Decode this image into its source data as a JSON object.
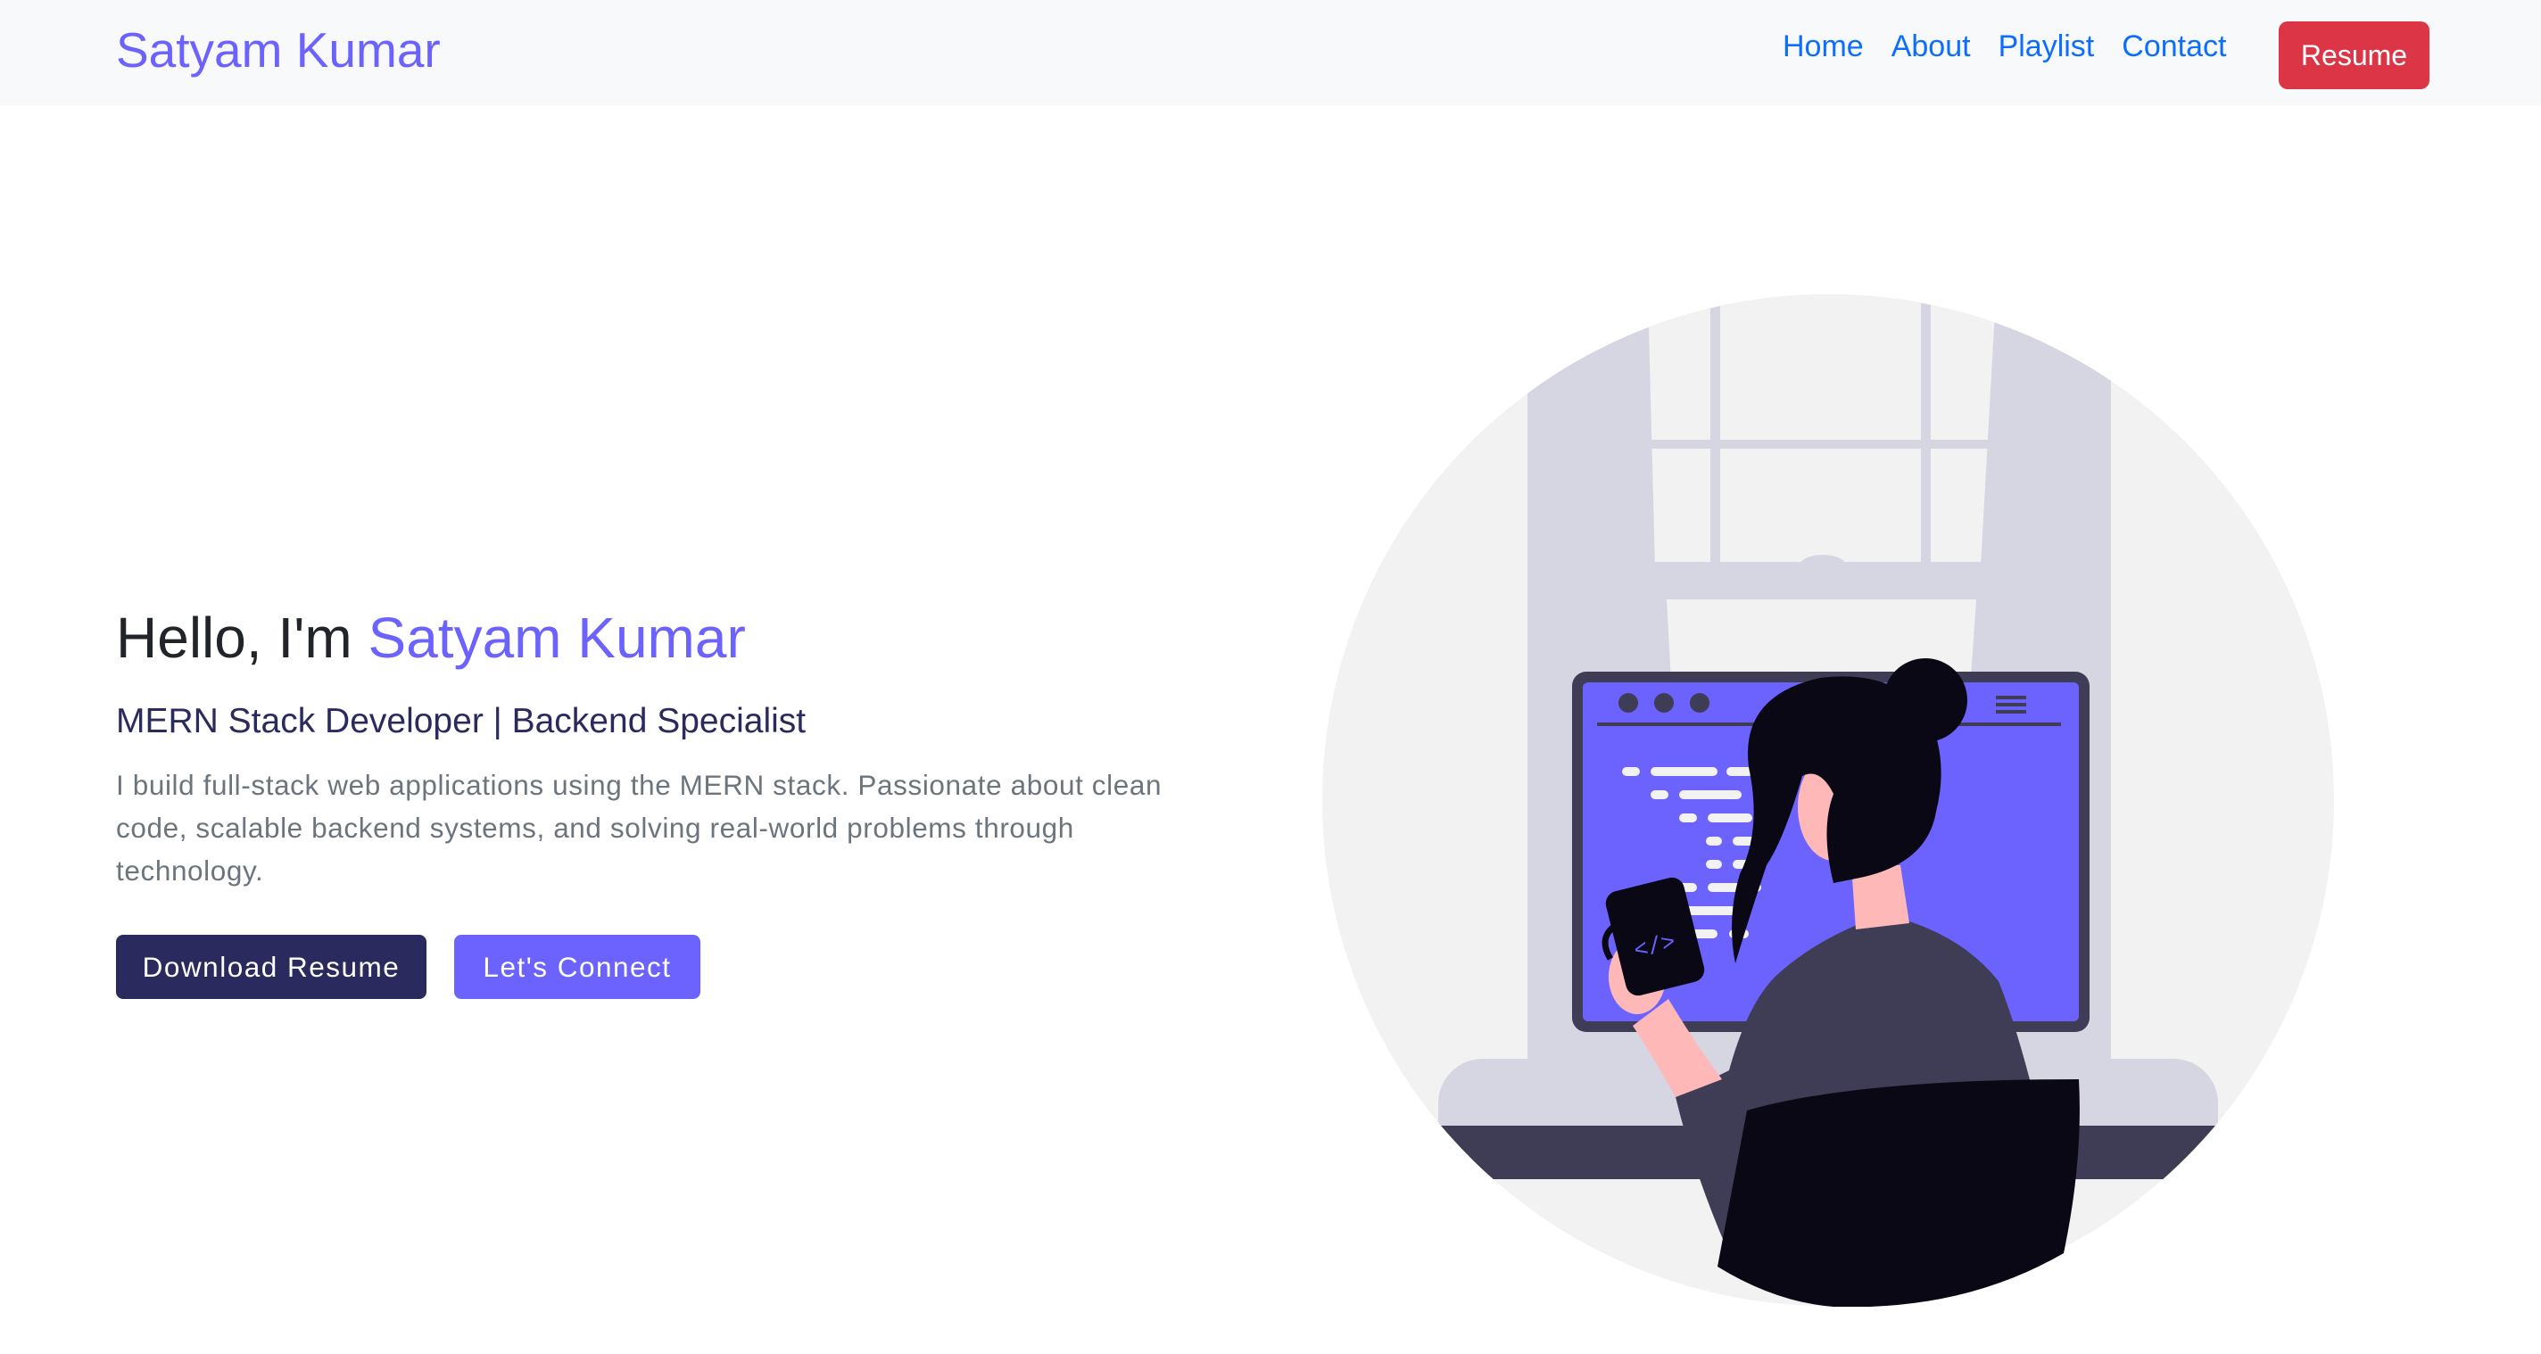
{
  "navbar": {
    "brand": "Satyam Kumar",
    "links": [
      {
        "label": "Home"
      },
      {
        "label": "About"
      },
      {
        "label": "Playlist"
      },
      {
        "label": "Contact"
      }
    ],
    "resume_label": "Resume"
  },
  "hero": {
    "greeting": "Hello, I'm ",
    "name": "Satyam Kumar",
    "subtitle": "MERN Stack Developer | Backend Specialist",
    "description": "I build full-stack web applications using the MERN stack. Passionate about clean code, scalable backend systems, and solving real-world problems through technology.",
    "download_label": "Download Resume",
    "connect_label": "Let's Connect",
    "illustration_icon": "developer-illustration",
    "mug_text": "</>"
  },
  "colors": {
    "accent": "#6c63ff",
    "dark": "#2b2a5e",
    "link": "#0d6efd",
    "danger": "#dc3545",
    "navbar_bg": "#f8f9fa"
  }
}
